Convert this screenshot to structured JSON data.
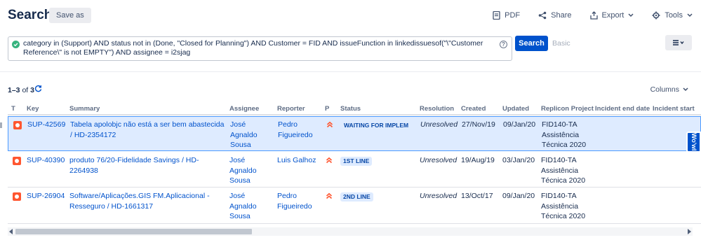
{
  "header": {
    "title": "Search",
    "save_as": "Save as",
    "actions": {
      "pdf": "PDF",
      "share": "Share",
      "export": "Export",
      "tools": "Tools"
    }
  },
  "query": {
    "text": "category in (Support) AND status not in (Done, \"Closed for Planning\") AND Customer = FID AND issueFunction in linkedissuesof(\"\\\"Customer Reference\\\" is not EMPTY\") AND assignee = i2sjag",
    "help": "?",
    "search_label": "Search",
    "basic_label": "Basic"
  },
  "results": {
    "range": "1–3",
    "of": "of",
    "total": "3",
    "columns_label": "Columns"
  },
  "table": {
    "headers": {
      "t": "T",
      "key": "Key",
      "summary": "Summary",
      "assignee": "Assignee",
      "reporter": "Reporter",
      "p": "P",
      "status": "Status",
      "resolution": "Resolution",
      "created": "Created",
      "updated": "Updated",
      "replicon": "Replicon Project",
      "incident_end": "Incident end date",
      "incident_start": "Incident start"
    },
    "rows": [
      {
        "key": "SUP-42569",
        "summary": "Tabela apolobjc não está a ser bem abastecida / HD-2354172",
        "assignee": "José Agnaldo Sousa",
        "reporter": "Pedro Figueiredo",
        "status": "WAITING FOR IMPLEM…",
        "resolution": "Unresolved",
        "created": "27/Nov/19",
        "updated": "09/Jan/20",
        "replicon": "FID140-TA Assistência Técnica 2020"
      },
      {
        "key": "SUP-40390",
        "summary": "produto 76/20-Fidelidade Savings / HD-2264938",
        "assignee": "José Agnaldo Sousa",
        "reporter": "Luis Galhoz",
        "status": "1ST LINE",
        "resolution": "Unresolved",
        "created": "19/Aug/19",
        "updated": "03/Jan/20",
        "replicon": "FID140-TA Assistência Técnica 2020"
      },
      {
        "key": "SUP-26904",
        "summary": "Software/Aplicações.GIS FM.Aplicacional - Resseguro / HD-1661317",
        "assignee": "José Agnaldo Sousa",
        "reporter": "Pedro Figueiredo",
        "status": "2ND LINE",
        "resolution": "Unresolved",
        "created": "13/Oct/17",
        "updated": "09/Jan/20",
        "replicon": "FID140-TA Assistência Técnica 2020"
      }
    ]
  },
  "side_tab": "Wo'wl",
  "colors": {
    "primary": "#0052cc",
    "selected_row": "#deebff",
    "bug_icon": "#ff5630",
    "priority": "#ff5630",
    "success": "#36b37e"
  }
}
